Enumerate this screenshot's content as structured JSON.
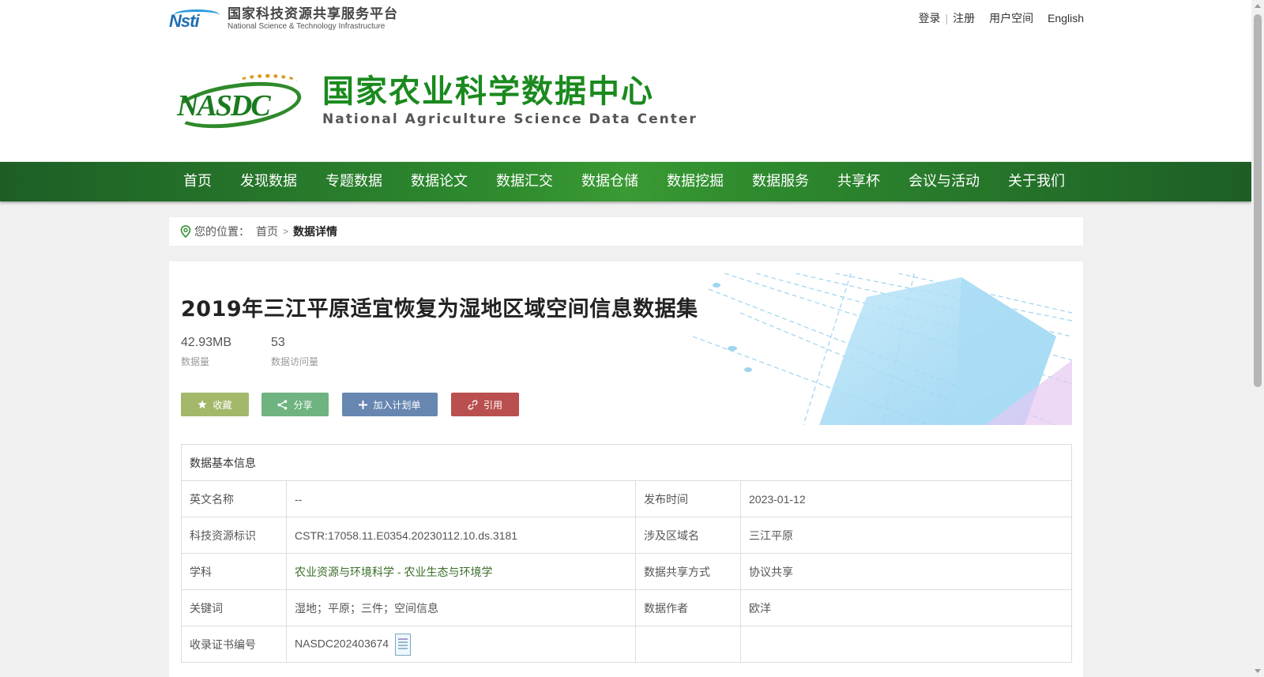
{
  "header": {
    "platform_cn": "国家科技资源共享服务平台",
    "platform_en": "National Science & Technology Infrastructure",
    "platform_logo_text": "Nsti",
    "links": {
      "login": "登录",
      "register": "注册",
      "user_space": "用户空间",
      "english": "English"
    },
    "center_logo_text": "NASDC",
    "center_cn": "国家农业科学数据中心",
    "center_en": "National Agriculture Science Data Center"
  },
  "nav": {
    "items": [
      "首页",
      "发现数据",
      "专题数据",
      "数据论文",
      "数据汇交",
      "数据仓储",
      "数据挖掘",
      "数据服务",
      "共享杯",
      "会议与活动",
      "关于我们"
    ]
  },
  "breadcrumb": {
    "prefix": "您的位置：",
    "home": "首页",
    "current": "数据详情"
  },
  "dataset": {
    "title": "2019年三江平原适宜恢复为湿地区域空间信息数据集",
    "stats": [
      {
        "value": "42.93MB",
        "label": "数据量"
      },
      {
        "value": "53",
        "label": "数据访问量"
      }
    ],
    "buttons": {
      "favorite": "收藏",
      "share": "分享",
      "add_plan": "加入计划单",
      "cite": "引用"
    },
    "colors": {
      "favorite": "#a3b86a",
      "share": "#6fb381",
      "add_plan": "#6787b1",
      "cite": "#b9504f"
    }
  },
  "info": {
    "heading": "数据基本信息",
    "rows": [
      {
        "l1": "英文名称",
        "v1": "--",
        "l2": "发布时间",
        "v2": "2023-01-12"
      },
      {
        "l1": "科技资源标识",
        "v1": "CSTR:17058.11.E0354.20230112.10.ds.3181",
        "l2": "涉及区域名",
        "v2": "三江平原"
      },
      {
        "l1": "学科",
        "v1a": "农业资源与环境科学",
        "v1sep": " - ",
        "v1b": "农业生态与环境学",
        "l2": "数据共享方式",
        "v2": "协议共享"
      },
      {
        "l1": "关键词",
        "v1": "湿地；平原；三件；空间信息",
        "l2": "数据作者",
        "v2": "欧洋"
      },
      {
        "l1": "收录证书编号",
        "v1": "NASDC202403674",
        "l2": "",
        "v2": ""
      }
    ]
  }
}
